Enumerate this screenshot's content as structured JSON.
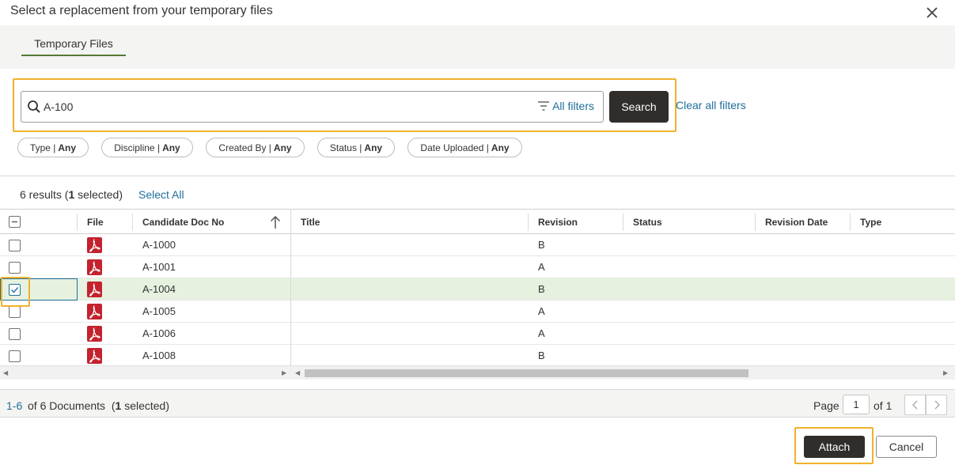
{
  "dialog": {
    "title": "Select a replacement from your temporary files",
    "close_icon": "close-icon"
  },
  "tabs": [
    {
      "label": "Temporary Files",
      "active": true
    }
  ],
  "search": {
    "value": "A-100",
    "all_filters_label": "All filters",
    "button_label": "Search",
    "clear_label": "Clear all filters"
  },
  "filters": [
    {
      "name": "Type",
      "value": "Any"
    },
    {
      "name": "Discipline",
      "value": "Any"
    },
    {
      "name": "Created By",
      "value": "Any"
    },
    {
      "name": "Status",
      "value": "Any"
    },
    {
      "name": "Date Uploaded",
      "value": "Any"
    }
  ],
  "results": {
    "count": "6",
    "count_suffix": " results (",
    "selected_count": "1",
    "selected_suffix": " selected)",
    "select_all_label": "Select All"
  },
  "table": {
    "columns": [
      "File",
      "Candidate Doc No",
      "Title",
      "Revision",
      "Status",
      "Revision Date",
      "Type"
    ],
    "rows": [
      {
        "doc_no": "A-1000",
        "title": "",
        "revision": "B",
        "selected": false
      },
      {
        "doc_no": "A-1001",
        "title": "",
        "revision": "A",
        "selected": false
      },
      {
        "doc_no": "A-1004",
        "title": "",
        "revision": "B",
        "selected": true
      },
      {
        "doc_no": "A-1005",
        "title": "",
        "revision": "A",
        "selected": false
      },
      {
        "doc_no": "A-1006",
        "title": "",
        "revision": "A",
        "selected": false
      },
      {
        "doc_no": "A-1008",
        "title": "",
        "revision": "B",
        "selected": false
      }
    ]
  },
  "footer": {
    "range": "1-6",
    "of_text": "of 6 Documents",
    "selected_open": "(",
    "selected_count": "1",
    "selected_close": " selected)",
    "page_label": "Page",
    "page_value": "1",
    "page_of": "of 1"
  },
  "actions": {
    "attach_label": "Attach",
    "cancel_label": "Cancel"
  },
  "colors": {
    "accent_dark": "#312d2a",
    "link": "#1f6f9c",
    "highlight": "#f1b12b",
    "tab_underline": "#557a35",
    "selected_row": "#e6f2df",
    "pdf_red": "#c4222e"
  }
}
